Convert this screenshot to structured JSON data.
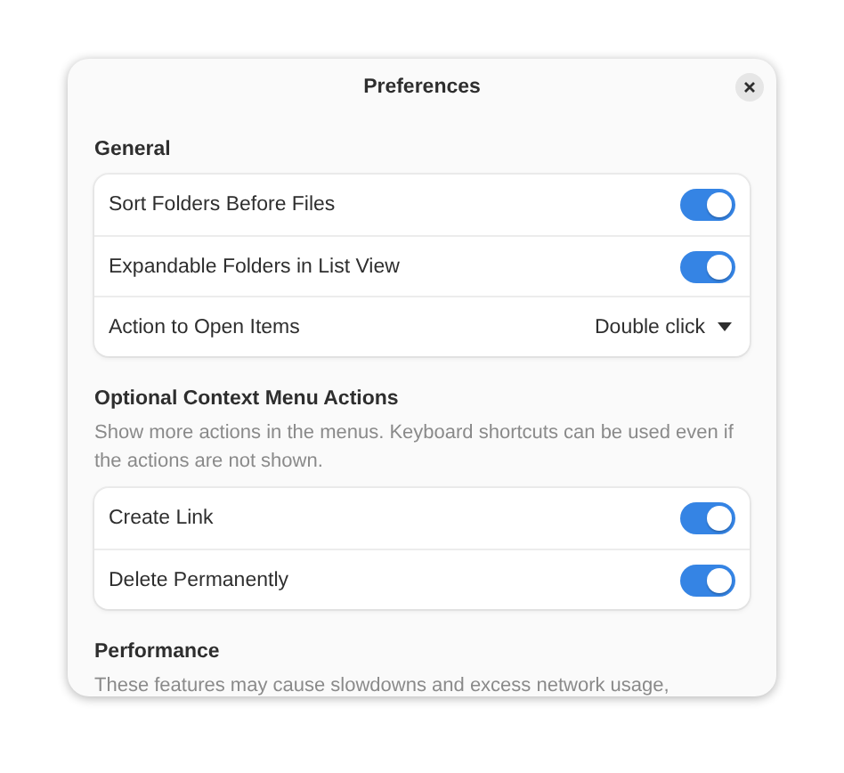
{
  "window": {
    "title": "Preferences"
  },
  "sections": [
    {
      "title": "General",
      "rows": [
        {
          "kind": "switch",
          "label": "Sort Folders Before Files",
          "on": true
        },
        {
          "kind": "switch",
          "label": "Expandable Folders in List View",
          "on": true
        },
        {
          "kind": "dropdown",
          "label": "Action to Open Items",
          "value": "Double click"
        }
      ]
    },
    {
      "title": "Optional Context Menu Actions",
      "description": "Show more actions in the menus. Keyboard shortcuts can be used even if the actions are not shown.",
      "rows": [
        {
          "kind": "switch",
          "label": "Create Link",
          "on": true
        },
        {
          "kind": "switch",
          "label": "Delete Permanently",
          "on": true
        }
      ]
    },
    {
      "title": "Performance",
      "description": "These features may cause slowdowns and excess network usage,"
    }
  ]
}
